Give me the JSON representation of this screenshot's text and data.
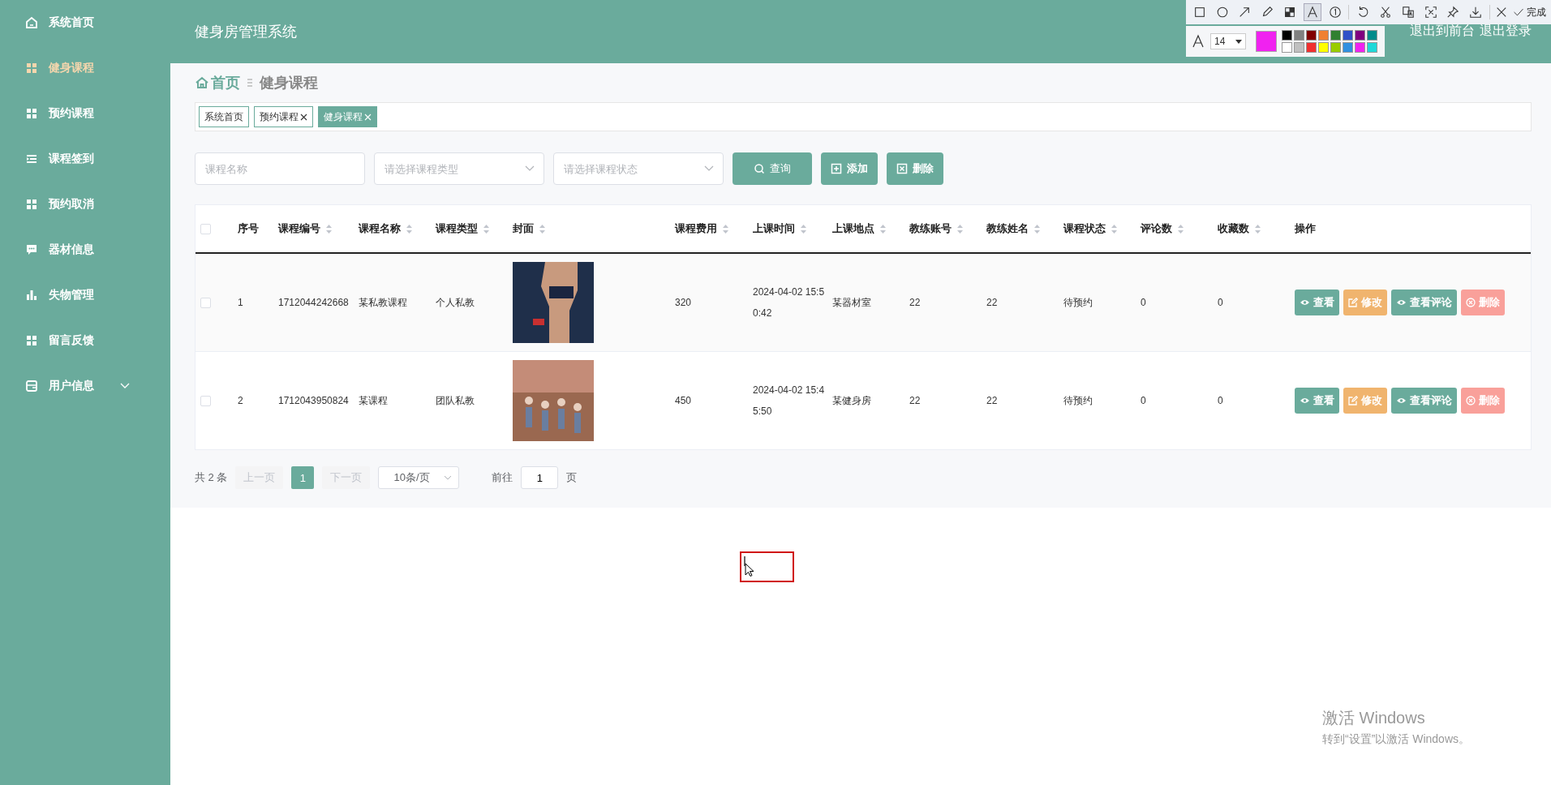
{
  "header": {
    "title": "健身房管理系统",
    "links": [
      "退出到前台",
      "退出登录"
    ]
  },
  "sidebar": {
    "items": [
      {
        "label": "系统首页",
        "selected": false
      },
      {
        "label": "健身课程",
        "selected": true
      },
      {
        "label": "预约课程",
        "selected": false
      },
      {
        "label": "课程签到",
        "selected": false
      },
      {
        "label": "预约取消",
        "selected": false
      },
      {
        "label": "器材信息",
        "selected": false
      },
      {
        "label": "失物管理",
        "selected": false
      },
      {
        "label": "留言反馈",
        "selected": false
      },
      {
        "label": "用户信息",
        "selected": false,
        "expanded": false
      }
    ]
  },
  "breadcrumb": [
    "首页",
    "健身课程"
  ],
  "tags": [
    {
      "label": "系统首页",
      "selected": false,
      "closable": false
    },
    {
      "label": "预约课程",
      "selected": false,
      "closable": true
    },
    {
      "label": "健身课程",
      "selected": true,
      "closable": true
    }
  ],
  "search": {
    "fields": [
      {
        "kind": "input",
        "placeholder": "课程名称"
      },
      {
        "kind": "select",
        "placeholder": "请选择课程类型"
      },
      {
        "kind": "select",
        "placeholder": "请选择课程状态"
      }
    ],
    "buttons": [
      {
        "kind": "search",
        "label": "查询"
      },
      {
        "kind": "add",
        "label": "添加"
      },
      {
        "kind": "delete",
        "label": "删除"
      }
    ]
  },
  "table": {
    "header_checked": false,
    "columns": [
      {
        "label": "序号",
        "sortable": false
      },
      {
        "label": "课程编号",
        "sortable": true
      },
      {
        "label": "课程名称",
        "sortable": true
      },
      {
        "label": "课程类型",
        "sortable": true
      },
      {
        "label": "封面",
        "sortable": true
      },
      {
        "label": "课程费用",
        "sortable": true
      },
      {
        "label": "上课时间",
        "sortable": true
      },
      {
        "label": "上课地点",
        "sortable": true
      },
      {
        "label": "教练账号",
        "sortable": true
      },
      {
        "label": "教练姓名",
        "sortable": true
      },
      {
        "label": "课程状态",
        "sortable": true
      },
      {
        "label": "评论数",
        "sortable": true
      },
      {
        "label": "收藏数",
        "sortable": true
      },
      {
        "label": "操作",
        "sortable": false
      }
    ],
    "rows": [
      {
        "checked": false,
        "cells": [
          "1",
          "1712044242668",
          "某私教课程",
          "个人私教",
          null,
          "320",
          "2024-04-02 15:50:42",
          "某器材室",
          "22",
          "22",
          "待预约",
          "0",
          "0"
        ],
        "actions": [
          {
            "kind": "view",
            "label": "查看"
          },
          {
            "kind": "edit",
            "label": "修改"
          },
          {
            "kind": "view",
            "label": "查看评论"
          },
          {
            "kind": "delete",
            "label": "删除"
          }
        ]
      },
      {
        "checked": false,
        "cells": [
          "2",
          "1712043950824",
          "某课程",
          "团队私教",
          null,
          "450",
          "2024-04-02 15:45:50",
          "某健身房",
          "22",
          "22",
          "待预约",
          "0",
          "0"
        ],
        "actions": [
          {
            "kind": "view",
            "label": "查看"
          },
          {
            "kind": "edit",
            "label": "修改"
          },
          {
            "kind": "view",
            "label": "查看评论"
          },
          {
            "kind": "delete",
            "label": "删除"
          }
        ]
      }
    ]
  },
  "pagination": {
    "total": "共 2 条",
    "prev": {
      "label": "上一页",
      "disabled": true
    },
    "pages": [
      {
        "label": "1",
        "selected": true
      }
    ],
    "next": {
      "label": "下一页",
      "disabled": true
    },
    "page_size": "10条/页",
    "goto_label": "前往",
    "goto_value": "1",
    "goto_suffix": "页"
  },
  "capture_toolbar": {
    "tools": [
      {
        "selected": false
      },
      {
        "selected": false
      },
      {
        "selected": false
      },
      {
        "selected": false
      },
      {
        "selected": false
      },
      {
        "selected": true
      },
      {
        "selected": false
      },
      {
        "selected": false
      },
      {
        "selected": false
      },
      {
        "selected": false
      },
      {
        "selected": false
      },
      {
        "selected": false
      },
      {
        "selected": false
      }
    ],
    "done": "完成",
    "font_size": "14",
    "current": {
      "color": "#f022f0"
    },
    "palette": [
      {
        "color": "#000000"
      },
      {
        "color": "#808080"
      },
      {
        "color": "#800000"
      },
      {
        "color": "#f08030"
      },
      {
        "color": "#308030"
      },
      {
        "color": "#3050c8"
      },
      {
        "color": "#800080"
      },
      {
        "color": "#008b8b"
      },
      {
        "color": "#ffffff"
      },
      {
        "color": "#c0c0c0"
      },
      {
        "color": "#f03030"
      },
      {
        "color": "#ffff00"
      },
      {
        "color": "#99cc00"
      },
      {
        "color": "#3090e0"
      },
      {
        "color": "#f022f0"
      },
      {
        "color": "#20d8d8"
      }
    ]
  },
  "activation": {
    "title": "激活 Windows",
    "subtitle": "转到“设置”以激活 Windows。"
  }
}
